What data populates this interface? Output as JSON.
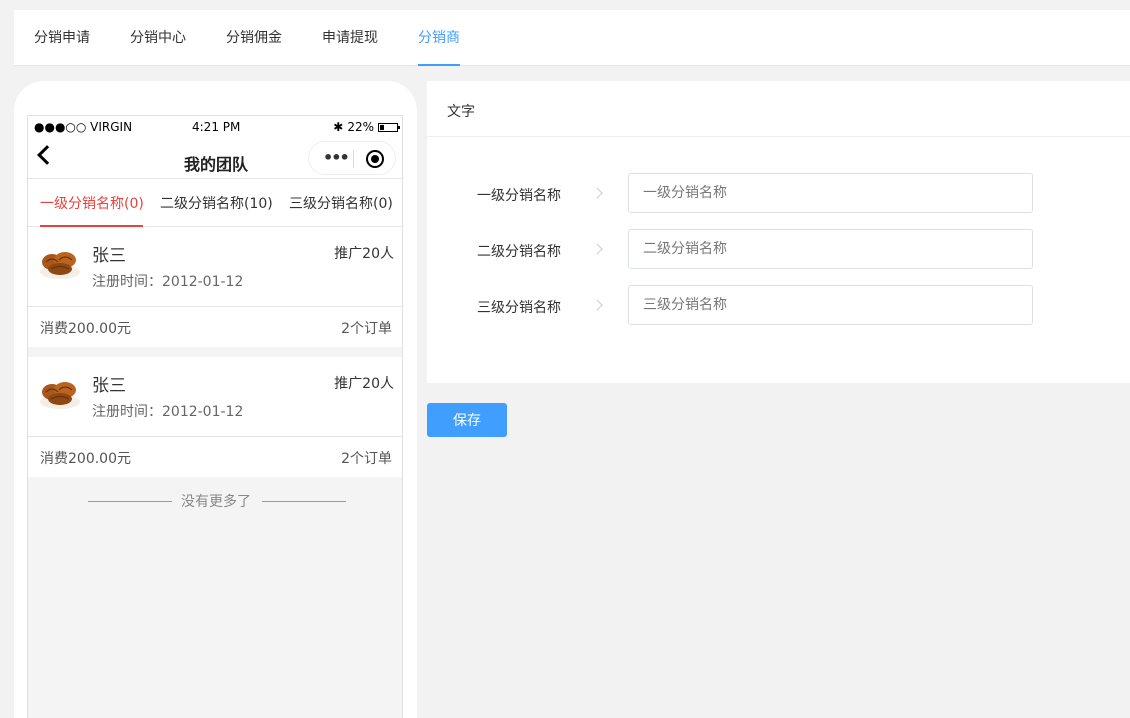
{
  "top_tabs": [
    {
      "label": "分销申请"
    },
    {
      "label": "分销中心"
    },
    {
      "label": "分销佣金"
    },
    {
      "label": "申请提现"
    },
    {
      "label": "分销商"
    }
  ],
  "active_tab": "分销商",
  "phone": {
    "status": {
      "carrier": "●●●○○ VIRGIN",
      "time": "4:21 PM",
      "battery": "22%"
    },
    "nav_title": "我的团队",
    "team_tabs": [
      {
        "label": "一级分销名称(0)"
      },
      {
        "label": "二级分销名称(10)"
      },
      {
        "label": "三级分销名称(0)"
      }
    ],
    "members": [
      {
        "name": "张三",
        "promoted": "推广20人",
        "register": "注册时间：2012-01-12",
        "spend": "消费200.00元",
        "orders": "2个订单"
      },
      {
        "name": "张三",
        "promoted": "推广20人",
        "register": "注册时间：2012-01-12",
        "spend": "消费200.00元",
        "orders": "2个订单"
      }
    ],
    "no_more": "没有更多了"
  },
  "panel": {
    "title": "文字",
    "rows": [
      {
        "label": "一级分销名称",
        "placeholder": "一级分销名称",
        "value": ""
      },
      {
        "label": "二级分销名称",
        "placeholder": "二级分销名称",
        "value": ""
      },
      {
        "label": "三级分销名称",
        "placeholder": "三级分销名称",
        "value": ""
      }
    ],
    "save_label": "保存"
  },
  "colors": {
    "accent": "#409eff",
    "tab_active_red": "#e64340",
    "background": "#f2f2f2"
  }
}
